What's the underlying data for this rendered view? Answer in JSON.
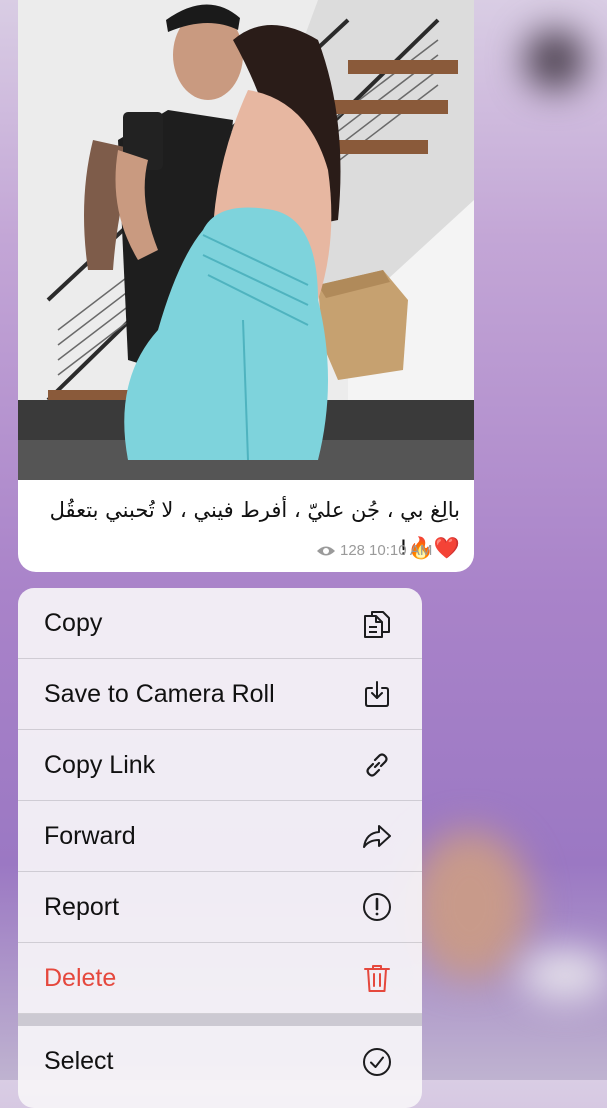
{
  "message": {
    "caption": "بالِغ بي ، جُن عليّ ، أفرط فيني ، لا تُحبني بتعقُل ❤️🔥!",
    "views": "128",
    "time": "10:10 AM"
  },
  "menu": {
    "items": [
      {
        "label": "Copy",
        "icon": "copy-icon",
        "style": "normal"
      },
      {
        "label": "Save to Camera Roll",
        "icon": "download-icon",
        "style": "normal"
      },
      {
        "label": "Copy Link",
        "icon": "link-icon",
        "style": "normal"
      },
      {
        "label": "Forward",
        "icon": "forward-arrow-icon",
        "style": "normal"
      },
      {
        "label": "Report",
        "icon": "exclamation-circle-icon",
        "style": "normal"
      },
      {
        "label": "Delete",
        "icon": "trash-icon",
        "style": "danger"
      }
    ],
    "secondary_items": [
      {
        "label": "Select",
        "icon": "checkmark-circle-icon",
        "style": "normal"
      }
    ]
  },
  "colors": {
    "danger": "#e5483d",
    "background_accent": "#a983c9",
    "photo_dress": "#7ed3dc"
  }
}
